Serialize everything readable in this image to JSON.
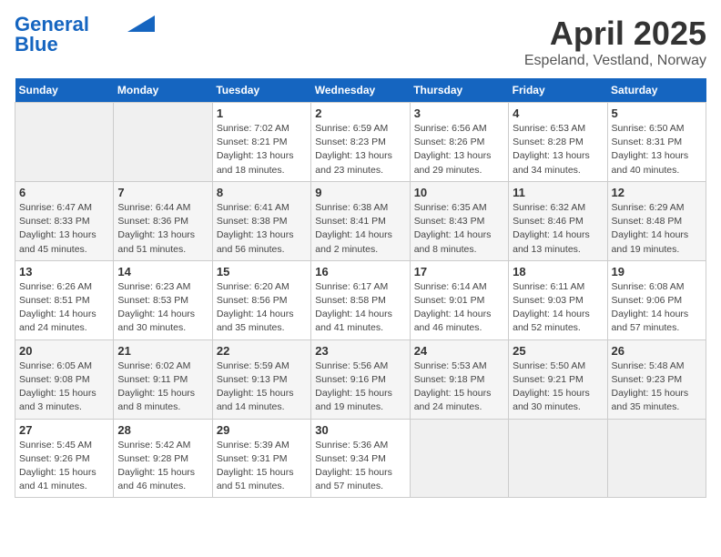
{
  "header": {
    "logo_line1": "General",
    "logo_line2": "Blue",
    "title": "April 2025",
    "subtitle": "Espeland, Vestland, Norway"
  },
  "days_of_week": [
    "Sunday",
    "Monday",
    "Tuesday",
    "Wednesday",
    "Thursday",
    "Friday",
    "Saturday"
  ],
  "weeks": [
    [
      {
        "day": "",
        "detail": ""
      },
      {
        "day": "",
        "detail": ""
      },
      {
        "day": "1",
        "detail": "Sunrise: 7:02 AM\nSunset: 8:21 PM\nDaylight: 13 hours and 18 minutes."
      },
      {
        "day": "2",
        "detail": "Sunrise: 6:59 AM\nSunset: 8:23 PM\nDaylight: 13 hours and 23 minutes."
      },
      {
        "day": "3",
        "detail": "Sunrise: 6:56 AM\nSunset: 8:26 PM\nDaylight: 13 hours and 29 minutes."
      },
      {
        "day": "4",
        "detail": "Sunrise: 6:53 AM\nSunset: 8:28 PM\nDaylight: 13 hours and 34 minutes."
      },
      {
        "day": "5",
        "detail": "Sunrise: 6:50 AM\nSunset: 8:31 PM\nDaylight: 13 hours and 40 minutes."
      }
    ],
    [
      {
        "day": "6",
        "detail": "Sunrise: 6:47 AM\nSunset: 8:33 PM\nDaylight: 13 hours and 45 minutes."
      },
      {
        "day": "7",
        "detail": "Sunrise: 6:44 AM\nSunset: 8:36 PM\nDaylight: 13 hours and 51 minutes."
      },
      {
        "day": "8",
        "detail": "Sunrise: 6:41 AM\nSunset: 8:38 PM\nDaylight: 13 hours and 56 minutes."
      },
      {
        "day": "9",
        "detail": "Sunrise: 6:38 AM\nSunset: 8:41 PM\nDaylight: 14 hours and 2 minutes."
      },
      {
        "day": "10",
        "detail": "Sunrise: 6:35 AM\nSunset: 8:43 PM\nDaylight: 14 hours and 8 minutes."
      },
      {
        "day": "11",
        "detail": "Sunrise: 6:32 AM\nSunset: 8:46 PM\nDaylight: 14 hours and 13 minutes."
      },
      {
        "day": "12",
        "detail": "Sunrise: 6:29 AM\nSunset: 8:48 PM\nDaylight: 14 hours and 19 minutes."
      }
    ],
    [
      {
        "day": "13",
        "detail": "Sunrise: 6:26 AM\nSunset: 8:51 PM\nDaylight: 14 hours and 24 minutes."
      },
      {
        "day": "14",
        "detail": "Sunrise: 6:23 AM\nSunset: 8:53 PM\nDaylight: 14 hours and 30 minutes."
      },
      {
        "day": "15",
        "detail": "Sunrise: 6:20 AM\nSunset: 8:56 PM\nDaylight: 14 hours and 35 minutes."
      },
      {
        "day": "16",
        "detail": "Sunrise: 6:17 AM\nSunset: 8:58 PM\nDaylight: 14 hours and 41 minutes."
      },
      {
        "day": "17",
        "detail": "Sunrise: 6:14 AM\nSunset: 9:01 PM\nDaylight: 14 hours and 46 minutes."
      },
      {
        "day": "18",
        "detail": "Sunrise: 6:11 AM\nSunset: 9:03 PM\nDaylight: 14 hours and 52 minutes."
      },
      {
        "day": "19",
        "detail": "Sunrise: 6:08 AM\nSunset: 9:06 PM\nDaylight: 14 hours and 57 minutes."
      }
    ],
    [
      {
        "day": "20",
        "detail": "Sunrise: 6:05 AM\nSunset: 9:08 PM\nDaylight: 15 hours and 3 minutes."
      },
      {
        "day": "21",
        "detail": "Sunrise: 6:02 AM\nSunset: 9:11 PM\nDaylight: 15 hours and 8 minutes."
      },
      {
        "day": "22",
        "detail": "Sunrise: 5:59 AM\nSunset: 9:13 PM\nDaylight: 15 hours and 14 minutes."
      },
      {
        "day": "23",
        "detail": "Sunrise: 5:56 AM\nSunset: 9:16 PM\nDaylight: 15 hours and 19 minutes."
      },
      {
        "day": "24",
        "detail": "Sunrise: 5:53 AM\nSunset: 9:18 PM\nDaylight: 15 hours and 24 minutes."
      },
      {
        "day": "25",
        "detail": "Sunrise: 5:50 AM\nSunset: 9:21 PM\nDaylight: 15 hours and 30 minutes."
      },
      {
        "day": "26",
        "detail": "Sunrise: 5:48 AM\nSunset: 9:23 PM\nDaylight: 15 hours and 35 minutes."
      }
    ],
    [
      {
        "day": "27",
        "detail": "Sunrise: 5:45 AM\nSunset: 9:26 PM\nDaylight: 15 hours and 41 minutes."
      },
      {
        "day": "28",
        "detail": "Sunrise: 5:42 AM\nSunset: 9:28 PM\nDaylight: 15 hours and 46 minutes."
      },
      {
        "day": "29",
        "detail": "Sunrise: 5:39 AM\nSunset: 9:31 PM\nDaylight: 15 hours and 51 minutes."
      },
      {
        "day": "30",
        "detail": "Sunrise: 5:36 AM\nSunset: 9:34 PM\nDaylight: 15 hours and 57 minutes."
      },
      {
        "day": "",
        "detail": ""
      },
      {
        "day": "",
        "detail": ""
      },
      {
        "day": "",
        "detail": ""
      }
    ]
  ]
}
